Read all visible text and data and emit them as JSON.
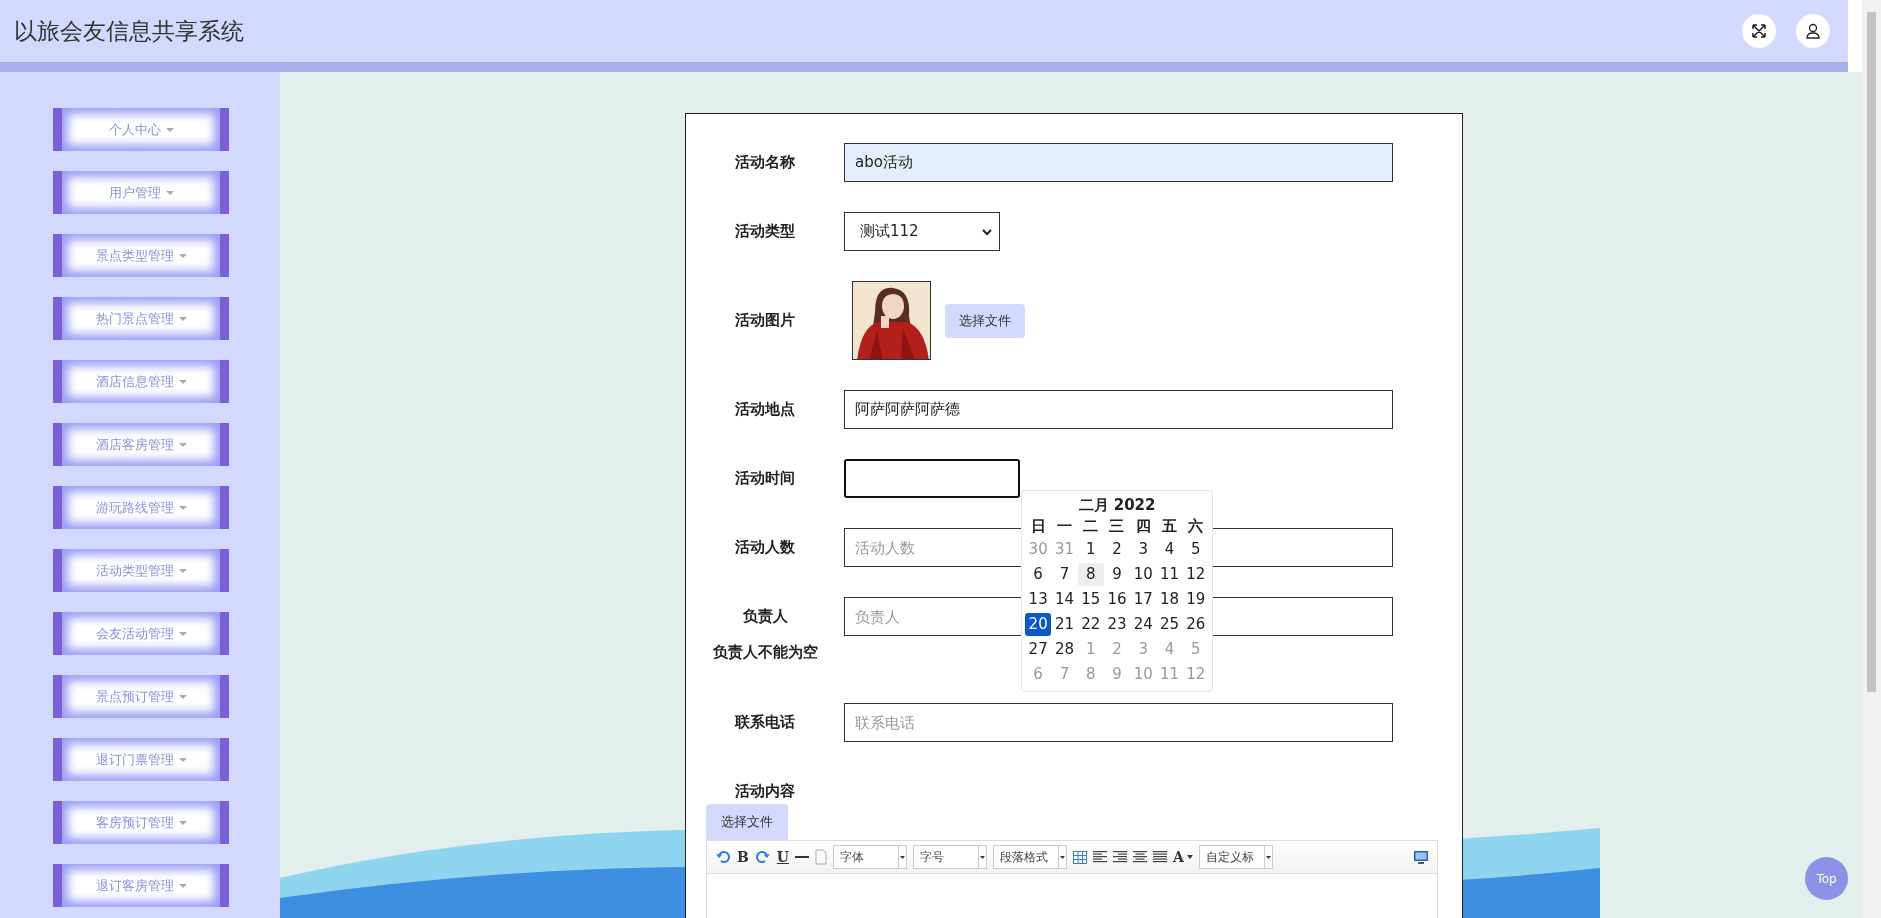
{
  "header": {
    "title": "以旅会友信息共享系统"
  },
  "sidebar": {
    "items": [
      {
        "label": "个人中心"
      },
      {
        "label": "用户管理"
      },
      {
        "label": "景点类型管理"
      },
      {
        "label": "热门景点管理"
      },
      {
        "label": "酒店信息管理"
      },
      {
        "label": "酒店客房管理"
      },
      {
        "label": "游玩路线管理"
      },
      {
        "label": "活动类型管理"
      },
      {
        "label": "会友活动管理"
      },
      {
        "label": "景点预订管理"
      },
      {
        "label": "退订门票管理"
      },
      {
        "label": "客房预订管理"
      },
      {
        "label": "退订客房管理"
      }
    ]
  },
  "form": {
    "rows": [
      {
        "kind": "text",
        "label": "活动名称",
        "value": "abo活动",
        "autofilled": true,
        "focused": false
      },
      {
        "kind": "select",
        "label": "活动类型",
        "value": "测试112"
      },
      {
        "label": "活动图片",
        "button": "选择文件"
      },
      {
        "kind": "text",
        "label": "活动地点",
        "value": "阿萨阿萨阿萨德",
        "autofilled": false,
        "focused": false
      },
      {
        "kind": "date",
        "label": "活动时间",
        "autofilled": false,
        "focused": true
      },
      {
        "kind": "text",
        "label": "活动人数",
        "placeholder": "活动人数",
        "autofilled": false,
        "focused": false
      },
      {
        "kind": "text",
        "label": "负责人",
        "placeholder": "负责人",
        "error": "负责人不能为空",
        "autofilled": false,
        "focused": false
      },
      {
        "kind": "text",
        "label": "联系电话",
        "placeholder": "联系电话",
        "autofilled": false,
        "focused": false
      },
      {
        "kind": "editor",
        "label": "活动内容"
      }
    ]
  },
  "calendar": {
    "title": "二月 2022",
    "weekdays": [
      "日",
      "一",
      "二",
      "三",
      "四",
      "五",
      "六"
    ],
    "weeks": [
      [
        {
          "day": "30",
          "muted": true,
          "selected": false,
          "hovered": false
        },
        {
          "day": "31",
          "muted": true,
          "selected": false,
          "hovered": false
        },
        {
          "day": "1",
          "muted": false,
          "selected": false,
          "hovered": false
        },
        {
          "day": "2",
          "muted": false,
          "selected": false,
          "hovered": false
        },
        {
          "day": "3",
          "muted": false,
          "selected": false,
          "hovered": false
        },
        {
          "day": "4",
          "muted": false,
          "selected": false,
          "hovered": false
        },
        {
          "day": "5",
          "muted": false,
          "selected": false,
          "hovered": false
        }
      ],
      [
        {
          "day": "6",
          "muted": false,
          "selected": false,
          "hovered": false
        },
        {
          "day": "7",
          "muted": false,
          "selected": false,
          "hovered": false
        },
        {
          "day": "8",
          "muted": false,
          "selected": false,
          "hovered": true
        },
        {
          "day": "9",
          "muted": false,
          "selected": false,
          "hovered": false
        },
        {
          "day": "10",
          "muted": false,
          "selected": false,
          "hovered": false
        },
        {
          "day": "11",
          "muted": false,
          "selected": false,
          "hovered": false
        },
        {
          "day": "12",
          "muted": false,
          "selected": false,
          "hovered": false
        }
      ],
      [
        {
          "day": "13",
          "muted": false,
          "selected": false,
          "hovered": false
        },
        {
          "day": "14",
          "muted": false,
          "selected": false,
          "hovered": false
        },
        {
          "day": "15",
          "muted": false,
          "selected": false,
          "hovered": false
        },
        {
          "day": "16",
          "muted": false,
          "selected": false,
          "hovered": false
        },
        {
          "day": "17",
          "muted": false,
          "selected": false,
          "hovered": false
        },
        {
          "day": "18",
          "muted": false,
          "selected": false,
          "hovered": false
        },
        {
          "day": "19",
          "muted": false,
          "selected": false,
          "hovered": false
        }
      ],
      [
        {
          "day": "20",
          "muted": false,
          "selected": true,
          "hovered": false
        },
        {
          "day": "21",
          "muted": false,
          "selected": false,
          "hovered": false
        },
        {
          "day": "22",
          "muted": false,
          "selected": false,
          "hovered": false
        },
        {
          "day": "23",
          "muted": false,
          "selected": false,
          "hovered": false
        },
        {
          "day": "24",
          "muted": false,
          "selected": false,
          "hovered": false
        },
        {
          "day": "25",
          "muted": false,
          "selected": false,
          "hovered": false
        },
        {
          "day": "26",
          "muted": false,
          "selected": false,
          "hovered": false
        }
      ],
      [
        {
          "day": "27",
          "muted": false,
          "selected": false,
          "hovered": false
        },
        {
          "day": "28",
          "muted": false,
          "selected": false,
          "hovered": false
        },
        {
          "day": "1",
          "muted": true,
          "selected": false,
          "hovered": false
        },
        {
          "day": "2",
          "muted": true,
          "selected": false,
          "hovered": false
        },
        {
          "day": "3",
          "muted": true,
          "selected": false,
          "hovered": false
        },
        {
          "day": "4",
          "muted": true,
          "selected": false,
          "hovered": false
        },
        {
          "day": "5",
          "muted": true,
          "selected": false,
          "hovered": false
        }
      ],
      [
        {
          "day": "6",
          "muted": true,
          "selected": false,
          "hovered": false
        },
        {
          "day": "7",
          "muted": true,
          "selected": false,
          "hovered": false
        },
        {
          "day": "8",
          "muted": true,
          "selected": false,
          "hovered": false
        },
        {
          "day": "9",
          "muted": true,
          "selected": false,
          "hovered": false
        },
        {
          "day": "10",
          "muted": true,
          "selected": false,
          "hovered": false
        },
        {
          "day": "11",
          "muted": true,
          "selected": false,
          "hovered": false
        },
        {
          "day": "12",
          "muted": true,
          "selected": false,
          "hovered": false
        }
      ]
    ]
  },
  "editor": {
    "upload_button": "选择文件",
    "toolbar": [
      {
        "kind": "undo"
      },
      {
        "kind": "bold",
        "text": "B"
      },
      {
        "kind": "redo"
      },
      {
        "kind": "underline",
        "text": "U"
      },
      {
        "kind": "rule"
      },
      {
        "kind": "page"
      },
      {
        "kind": "dropdown",
        "text": "字体"
      },
      {
        "kind": "dropdown",
        "text": "字号"
      },
      {
        "kind": "dropdown",
        "text": "段落格式"
      },
      {
        "kind": "table"
      },
      {
        "kind": "align-left"
      },
      {
        "kind": "align-right"
      },
      {
        "kind": "align-center"
      },
      {
        "kind": "justify"
      },
      {
        "kind": "color",
        "text": "A"
      },
      {
        "kind": "dropdown",
        "text": "自定义标"
      },
      {
        "kind": "preview"
      }
    ]
  },
  "top_button": "Top"
}
